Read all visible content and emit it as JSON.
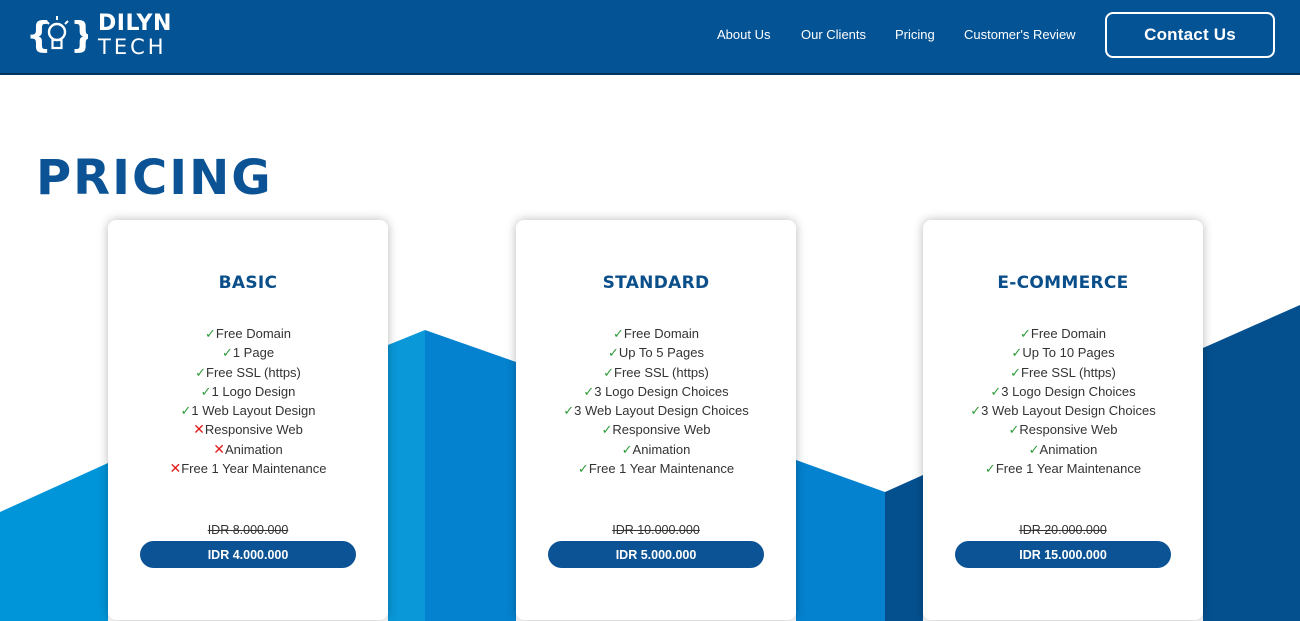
{
  "header": {
    "logo": {
      "line1": "DILYN",
      "line2": "TECH"
    },
    "nav": [
      {
        "label": "About Us"
      },
      {
        "label": "Our Clients"
      },
      {
        "label": "Pricing"
      },
      {
        "label": "Customer's Review"
      }
    ],
    "contact_label": "Contact Us"
  },
  "page": {
    "title": "PRICING"
  },
  "colors": {
    "header_bg": "#045395",
    "title": "#0b5394",
    "accent_light": "#0095d8",
    "accent_mid": "#0482cf",
    "accent_dark": "#04508f",
    "check": "#2e9c3a",
    "cross": "#e01b1b"
  },
  "plans": [
    {
      "name": "BASIC",
      "features": [
        {
          "mark": "✓",
          "ok": true,
          "text": "Free Domain"
        },
        {
          "mark": "✓",
          "ok": true,
          "text": "1 Page"
        },
        {
          "mark": "✓",
          "ok": true,
          "text": "Free SSL (https)"
        },
        {
          "mark": "✓",
          "ok": true,
          "text": "1 Logo Design"
        },
        {
          "mark": "✓",
          "ok": true,
          "text": "1 Web Layout Design"
        },
        {
          "mark": "✕",
          "ok": false,
          "text": "Responsive Web"
        },
        {
          "mark": "✕",
          "ok": false,
          "text": "Animation"
        },
        {
          "mark": "✕",
          "ok": false,
          "text": "Free 1 Year Maintenance"
        }
      ],
      "old_price": "IDR 8.000.000",
      "price": "IDR 4.000.000"
    },
    {
      "name": "STANDARD",
      "features": [
        {
          "mark": "✓",
          "ok": true,
          "text": "Free Domain"
        },
        {
          "mark": "✓",
          "ok": true,
          "text": "Up To 5 Pages"
        },
        {
          "mark": "✓",
          "ok": true,
          "text": "Free SSL (https)"
        },
        {
          "mark": "✓",
          "ok": true,
          "text": "3 Logo Design Choices"
        },
        {
          "mark": "✓",
          "ok": true,
          "text": "3 Web Layout Design Choices"
        },
        {
          "mark": "✓",
          "ok": true,
          "text": "Responsive Web"
        },
        {
          "mark": "✓",
          "ok": true,
          "text": "Animation"
        },
        {
          "mark": "✓",
          "ok": true,
          "text": "Free 1 Year Maintenance"
        }
      ],
      "old_price": "IDR 10.000.000",
      "price": "IDR 5.000.000"
    },
    {
      "name": "E-COMMERCE",
      "features": [
        {
          "mark": "✓",
          "ok": true,
          "text": "Free Domain"
        },
        {
          "mark": "✓",
          "ok": true,
          "text": "Up To 10 Pages"
        },
        {
          "mark": "✓",
          "ok": true,
          "text": "Free SSL (https)"
        },
        {
          "mark": "✓",
          "ok": true,
          "text": "3 Logo Design Choices"
        },
        {
          "mark": "✓",
          "ok": true,
          "text": "3 Web Layout Design Choices"
        },
        {
          "mark": "✓",
          "ok": true,
          "text": "Responsive Web"
        },
        {
          "mark": "✓",
          "ok": true,
          "text": "Animation"
        },
        {
          "mark": "✓",
          "ok": true,
          "text": "Free 1 Year Maintenance"
        }
      ],
      "old_price": "IDR 20.000.000",
      "price": "IDR 15.000.000"
    }
  ]
}
